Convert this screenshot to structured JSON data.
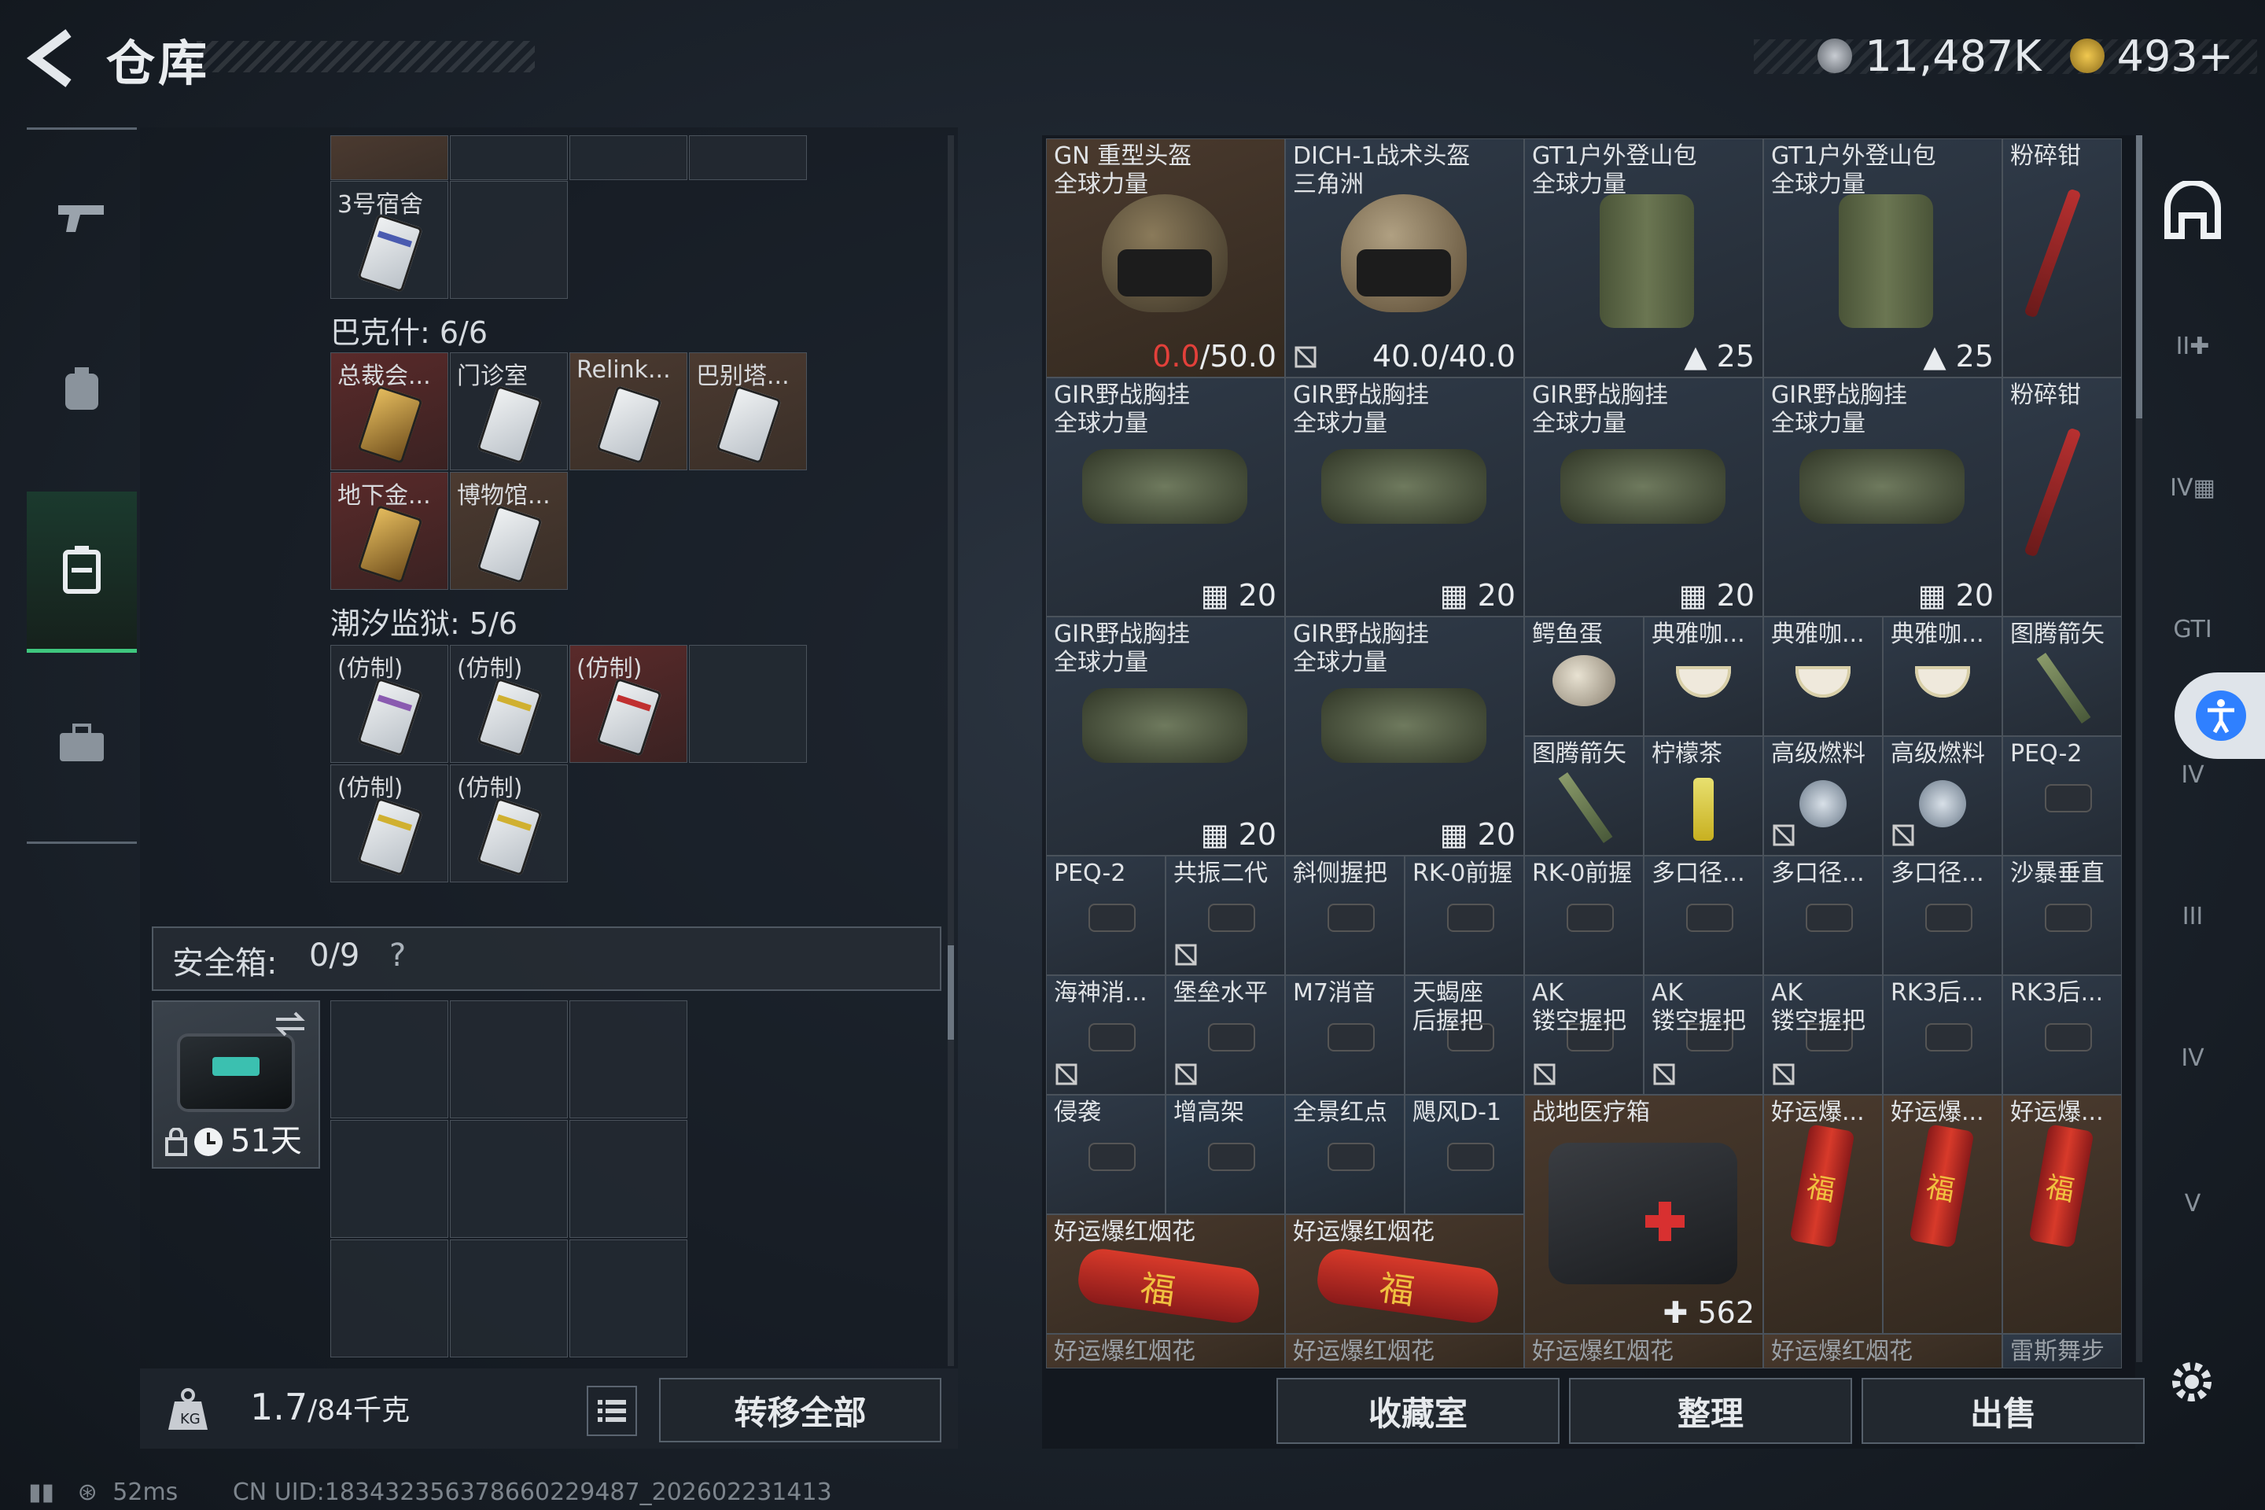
{
  "header": {
    "title": "仓库",
    "currency1": "11,487K",
    "currency2": "493+"
  },
  "left": {
    "room3": "3号宿舍",
    "section_bakesh": "巴克什: 6/6",
    "bakesh_items": [
      "总裁会...",
      "门诊室",
      "Relink...",
      "巴别塔...",
      "地下金...",
      "博物馆..."
    ],
    "section_prison": "潮汐监狱: 5/6",
    "prison_items": [
      "(仿制)",
      "(仿制)",
      "(仿制)",
      "(仿制)",
      "(仿制)"
    ],
    "safebox_label": "安全箱:",
    "safebox_value": "0/9",
    "safebox_help": "?",
    "safebox_days": "51天",
    "weight_value": "1.7",
    "weight_unit": "/84千克",
    "transfer_all": "转移全部"
  },
  "grid": {
    "row1": [
      {
        "name": "GN 重型头盔",
        "sub": "全球力量",
        "red": "0.0",
        "val": "/50.0"
      },
      {
        "name": "DICH-1战术头盔",
        "sub": "三角洲",
        "val": "40.0/40.0"
      },
      {
        "name": "GT1户外登山包",
        "sub": "全球力量",
        "val": "25"
      },
      {
        "name": "GT1户外登山包",
        "sub": "全球力量",
        "val": "25"
      },
      {
        "name": "粉碎钳"
      }
    ],
    "row2": [
      {
        "name": "GIR野战胸挂",
        "sub": "全球力量",
        "val": "20"
      },
      {
        "name": "GIR野战胸挂",
        "sub": "全球力量",
        "val": "20"
      },
      {
        "name": "GIR野战胸挂",
        "sub": "全球力量",
        "val": "20"
      },
      {
        "name": "GIR野战胸挂",
        "sub": "全球力量",
        "val": "20"
      },
      {
        "name": "粉碎钳"
      }
    ],
    "row3_big": [
      {
        "name": "GIR野战胸挂",
        "sub": "全球力量",
        "val": "20"
      },
      {
        "name": "GIR野战胸挂",
        "sub": "全球力量",
        "val": "20"
      }
    ],
    "row3_small": [
      "鳄鱼蛋",
      "典雅咖...",
      "典雅咖...",
      "典雅咖...",
      "图腾箭矢"
    ],
    "row4_small": [
      "图腾箭矢",
      "柠檬茶",
      "高级燃料",
      "高级燃料",
      "PEQ-2"
    ],
    "row5": [
      "PEQ-2",
      "共振二代",
      "斜侧握把",
      "RK-0前握",
      "RK-0前握",
      "多口径...",
      "多口径...",
      "多口径...",
      "沙暴垂直"
    ],
    "row6": [
      "海神消...",
      "堡垒水平",
      "M7消音",
      "天蝎座\n后握把",
      "AK\n镂空握把",
      "AK\n镂空握把",
      "AK\n镂空握把",
      "RK3后...",
      "RK3后..."
    ],
    "row7": [
      "侵袭",
      "增高架",
      "全景红点",
      "飓风D-1"
    ],
    "medkit": {
      "name": "战地医疗箱",
      "val": "562"
    },
    "crackers_v": [
      "好运爆...",
      "好运爆...",
      "好运爆..."
    ],
    "crackers_h": [
      "好运爆红烟花",
      "好运爆红烟花"
    ],
    "row9": [
      "好运爆红烟花",
      "好运爆红烟花",
      "好运爆红烟花",
      "好运爆红烟花",
      "雷斯舞步"
    ]
  },
  "buttons": {
    "collection": "收藏室",
    "organize": "整理",
    "sell": "出售"
  },
  "side_tabs": [
    "II",
    "IV",
    "GTI",
    "IV",
    "III",
    "IV",
    "V"
  ],
  "status": {
    "ping": "52ms",
    "uid": "CN UID:18343235637866022948​7_202602231413"
  }
}
